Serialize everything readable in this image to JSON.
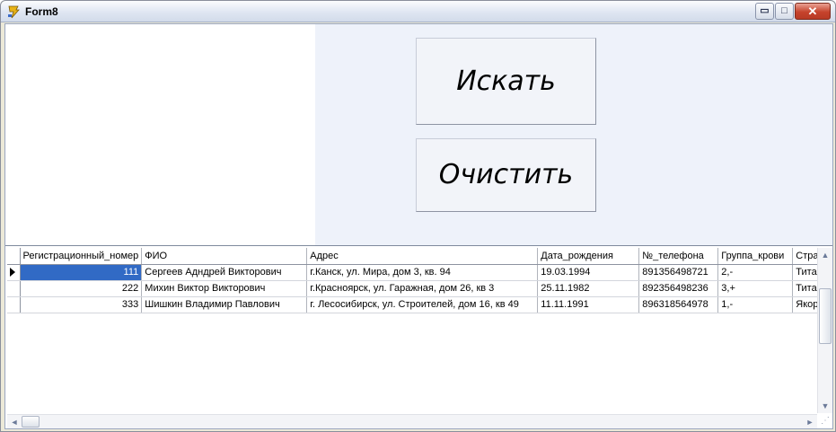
{
  "window": {
    "title": "Form8",
    "controls": {
      "minimize": "▭",
      "maximize": "□",
      "close": "✕"
    }
  },
  "buttons": {
    "search": "Искать",
    "clear": "Очистить"
  },
  "grid": {
    "columns": [
      "Регистрационный_номер",
      "ФИО",
      "Адрес",
      "Дата_рождения",
      "№_телефона",
      "Группа_крови",
      "Стра"
    ],
    "rows": [
      [
        "111",
        "Сергеев Адндрей Викторович",
        "г.Канск, ул. Мира, дом 3, кв. 94",
        "19.03.1994",
        "891356498721",
        "2,-",
        "Титан"
      ],
      [
        "222",
        "Михин Виктор Викторович",
        "г.Красноярск, ул. Гаражная, дом 26, кв 3",
        "25.11.1982",
        "892356498236",
        "3,+",
        "Титан"
      ],
      [
        "333",
        "Шишкин Владимир Павлович",
        "г. Лесосибирск, ул. Строителей, дом 16, кв 49",
        "11.11.1991",
        "896318564978",
        "1,-",
        "Якорь"
      ]
    ],
    "selected_row": 0
  },
  "icons": {
    "app": "delphi-app-icon",
    "row_pointer": "row-pointer-icon",
    "scroll_up": "▲",
    "scroll_down": "▼",
    "scroll_left": "◄",
    "scroll_right": "►",
    "grip": "⋰"
  }
}
